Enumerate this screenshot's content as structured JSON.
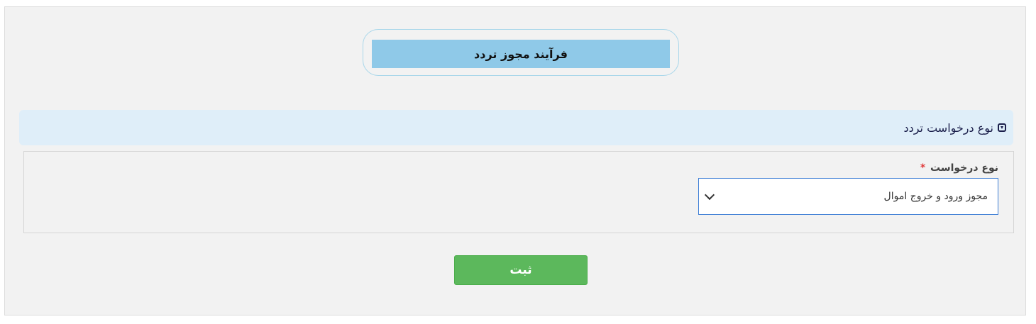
{
  "header": {
    "title": "فرآیند مجوز تردد"
  },
  "section": {
    "title": "نوع درخواست تردد",
    "toggle_icon": "collapse-square-icon"
  },
  "form": {
    "request_type": {
      "label": "نوع درخواست",
      "required_mark": "*",
      "selected_value": "مجوز ورود و خروج اموال",
      "dropdown_icon": "chevron-down-icon"
    }
  },
  "actions": {
    "submit_label": "ثبت"
  },
  "colors": {
    "title_bar": "#8fc9e8",
    "section_header": "#dfeef9",
    "submit_button": "#5cb85c",
    "required": "#e03a3a",
    "select_border": "#3f7fd6"
  }
}
